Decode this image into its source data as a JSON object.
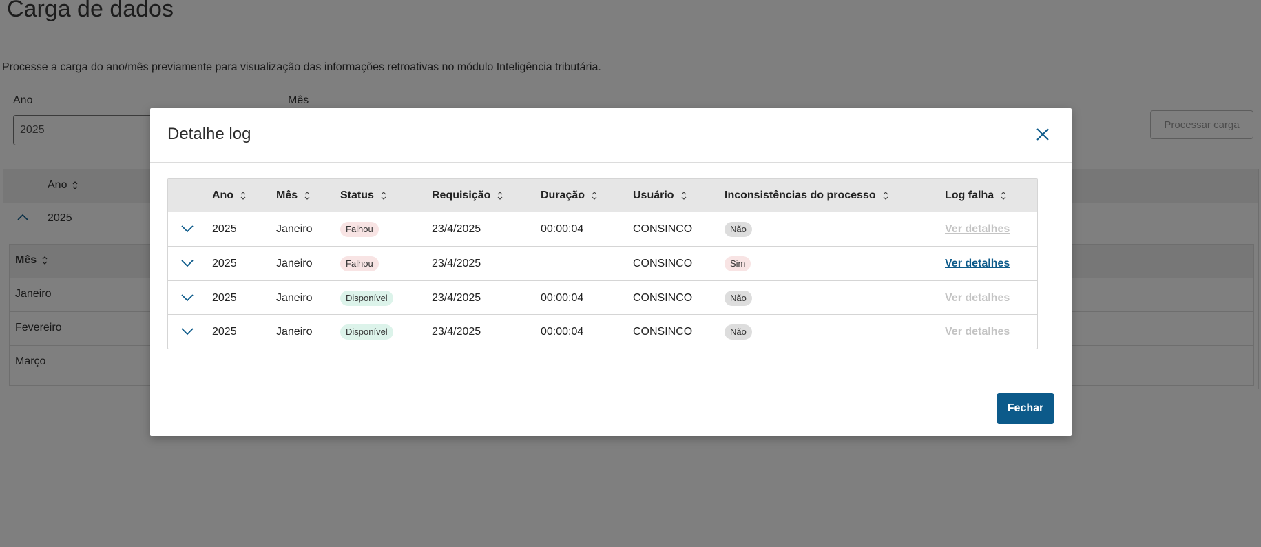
{
  "page": {
    "title": "Carga de dados",
    "description": "Processe a carga do ano/mês previamente para visualização das informações retroativas no módulo Inteligência tributária.",
    "ano_label": "Ano",
    "mes_label": "Mês",
    "ano_value": "2025",
    "process_button": "Processar carga",
    "table": {
      "header": "Ano",
      "row_year": "2025",
      "sub_header": "Mês",
      "months": [
        "Janeiro",
        "Fevereiro",
        "Março"
      ]
    }
  },
  "modal": {
    "title": "Detalhe log",
    "close_icon": "close-icon",
    "close_button": "Fechar",
    "columns": [
      "Ano",
      "Mês",
      "Status",
      "Requisição",
      "Duração",
      "Usuário",
      "Inconsistências do processo",
      "Log falha"
    ],
    "rows": [
      {
        "ano": "2025",
        "mes": "Janeiro",
        "status": "Falhou",
        "requisicao": "23/4/2025",
        "duracao": "00:00:04",
        "usuario": "CONSINCO",
        "inconsistencias": "Não",
        "log": "Ver detalhes",
        "log_enabled": false
      },
      {
        "ano": "2025",
        "mes": "Janeiro",
        "status": "Falhou",
        "requisicao": "23/4/2025",
        "duracao": "",
        "usuario": "CONSINCO",
        "inconsistencias": "Sim",
        "log": "Ver detalhes",
        "log_enabled": true
      },
      {
        "ano": "2025",
        "mes": "Janeiro",
        "status": "Disponível",
        "requisicao": "23/4/2025",
        "duracao": "00:00:04",
        "usuario": "CONSINCO",
        "inconsistencias": "Não",
        "log": "Ver detalhes",
        "log_enabled": false
      },
      {
        "ano": "2025",
        "mes": "Janeiro",
        "status": "Disponível",
        "requisicao": "23/4/2025",
        "duracao": "00:00:04",
        "usuario": "CONSINCO",
        "inconsistencias": "Não",
        "log": "Ver detalhes",
        "log_enabled": false
      }
    ]
  },
  "colors": {
    "primary": "#0c5a8a",
    "overlay": "rgba(0,0,0,0.5)",
    "tag_fail": "#f8e4e4",
    "tag_ok": "#dcf3ea",
    "tag_neutral": "#dddddd"
  }
}
